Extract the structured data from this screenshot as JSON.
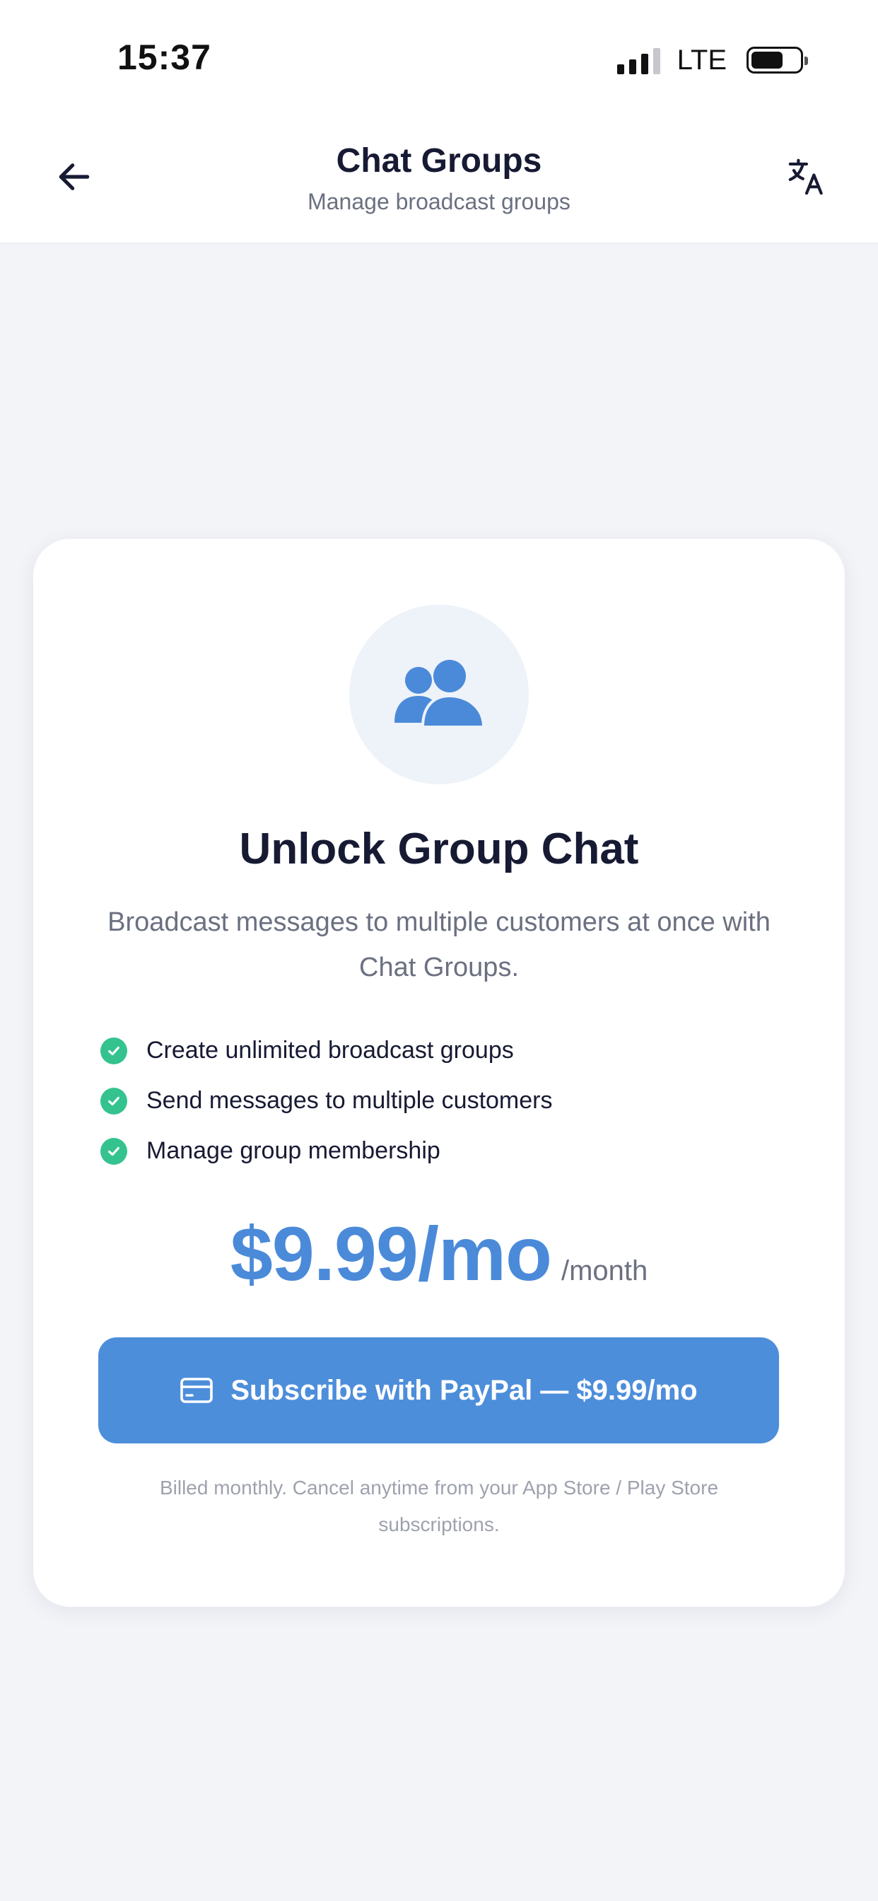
{
  "status_bar": {
    "time": "15:37",
    "network": "LTE"
  },
  "header": {
    "title": "Chat Groups",
    "subtitle": "Manage broadcast groups",
    "back_icon": "arrow-left-icon",
    "translate_icon": "translate-icon"
  },
  "card": {
    "icon": "users-icon",
    "title": "Unlock Group Chat",
    "description": "Broadcast messages to multiple customers at once with Chat Groups.",
    "features": [
      "Create unlimited broadcast groups",
      "Send messages to multiple customers",
      "Manage group membership"
    ],
    "price": "$9.99/mo",
    "period": "/month",
    "subscribe_label": "Subscribe with PayPal — $9.99/mo",
    "subscribe_icon": "credit-card-icon",
    "billing_note": "Billed monthly. Cancel anytime from your App Store / Play Store subscriptions."
  },
  "colors": {
    "accent": "#4d8edb",
    "check": "#34c38f",
    "title": "#171a33",
    "muted": "#6b7081",
    "background": "#f3f4f8"
  }
}
